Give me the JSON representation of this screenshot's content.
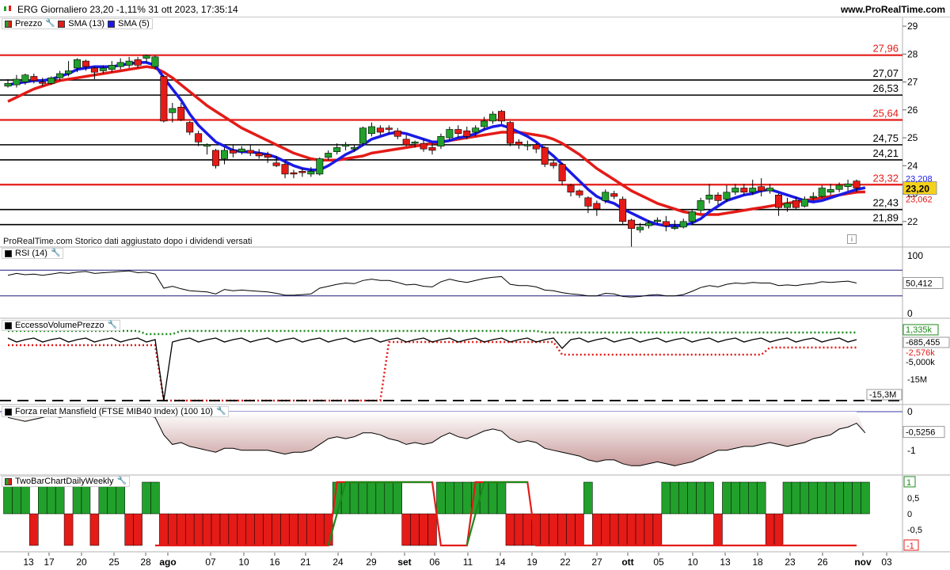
{
  "header": {
    "title": "ERG Giornaliero 23,20 -1,11% 31 ott 2023, 17:35:14",
    "site": "www.ProRealTime.com"
  },
  "colors": {
    "up": "#22a02c",
    "down": "#e41b17",
    "sma13": "#e41b17",
    "sma5": "#1a1ae6",
    "rsi_line": "#1a1a7a",
    "mansfield_fill": "#d9b4b4"
  },
  "price_panel": {
    "legend": {
      "price": "Prezzo",
      "sma13": "SMA (13)",
      "sma5": "SMA (5)"
    },
    "note": "ProRealTime.com  Storico dati aggiustato dopo i dividendi versati",
    "axis_ticks": [
      "29",
      "28",
      "27",
      "26",
      "25",
      "24",
      "23",
      "22"
    ],
    "levels": [
      {
        "value": 27.96,
        "label": "27,96",
        "color": "#e41b17"
      },
      {
        "value": 27.07,
        "label": "27,07",
        "color": "#000000"
      },
      {
        "value": 26.53,
        "label": "26,53",
        "color": "#000000"
      },
      {
        "value": 25.64,
        "label": "25,64",
        "color": "#e41b17"
      },
      {
        "value": 24.75,
        "label": "24,75",
        "color": "#000000"
      },
      {
        "value": 24.21,
        "label": "24,21",
        "color": "#000000"
      },
      {
        "value": 23.32,
        "label": "23,32",
        "color": "#e41b17"
      },
      {
        "value": 22.43,
        "label": "22,43",
        "color": "#000000"
      },
      {
        "value": 21.89,
        "label": "21,89",
        "color": "#000000"
      }
    ],
    "last_price_label": "23,20",
    "sma5_label": "23,208",
    "sma13_label": "23,062"
  },
  "rsi_panel": {
    "legend": "RSI (14)",
    "axis_top": "100",
    "axis_bottom": "0",
    "value_label": "50,412",
    "upper": 70,
    "lower": 30
  },
  "volume_panel": {
    "legend": "EccessoVolumePrezzo",
    "labels": {
      "green": "1,335k",
      "black": "-685,455",
      "tick5": "-5,000k",
      "red": "-2,576k",
      "tick15": "-15M",
      "dash": "-15,3M"
    }
  },
  "mansfield_panel": {
    "legend": "Forza relat Mansfield (FTSE MIB40 Index) (100 10)",
    "axis_ticks": [
      "0",
      "-1"
    ],
    "value_label": "-0,5256"
  },
  "twobar_panel": {
    "legend": "TwoBarChartDailyWeekly",
    "axis_ticks": [
      "1",
      "0,5",
      "0",
      "-0,5",
      "-1"
    ],
    "top_label": "1",
    "bottom_label": "-1"
  },
  "x_axis": {
    "labels": [
      "13",
      "17",
      "20",
      "25",
      "28",
      "ago",
      "07",
      "10",
      "16",
      "21",
      "24",
      "29",
      "set",
      "06",
      "11",
      "14",
      "19",
      "22",
      "27",
      "ott",
      "05",
      "10",
      "13",
      "18",
      "23",
      "26",
      "nov",
      "03"
    ]
  },
  "chart_data": {
    "type": "candlestick",
    "title": "ERG Giornaliero",
    "ylim": [
      21.2,
      29.2
    ],
    "candles": [
      [
        26.85,
        26.95,
        26.8,
        27.1
      ],
      [
        26.9,
        27.1,
        26.8,
        27.25
      ],
      [
        27.0,
        27.25,
        26.9,
        27.3
      ],
      [
        27.2,
        27.05,
        26.95,
        27.3
      ],
      [
        27.0,
        26.95,
        26.85,
        27.15
      ],
      [
        26.95,
        27.15,
        26.9,
        27.2
      ],
      [
        27.15,
        27.3,
        27.05,
        27.4
      ],
      [
        27.3,
        27.4,
        27.2,
        27.75
      ],
      [
        27.5,
        27.8,
        27.35,
        27.85
      ],
      [
        27.75,
        27.55,
        27.4,
        27.8
      ],
      [
        27.5,
        27.35,
        27.1,
        27.55
      ],
      [
        27.4,
        27.5,
        27.3,
        27.6
      ],
      [
        27.45,
        27.6,
        27.35,
        27.75
      ],
      [
        27.55,
        27.7,
        27.45,
        27.85
      ],
      [
        27.6,
        27.75,
        27.5,
        27.9
      ],
      [
        27.8,
        27.6,
        27.5,
        27.9
      ],
      [
        27.85,
        27.95,
        27.7,
        27.98
      ],
      [
        27.55,
        27.9,
        27.45,
        27.95
      ],
      [
        27.2,
        25.6,
        25.55,
        27.25
      ],
      [
        25.9,
        26.05,
        25.55,
        26.25
      ],
      [
        26.1,
        25.65,
        25.6,
        26.25
      ],
      [
        25.55,
        25.2,
        25.1,
        25.6
      ],
      [
        25.15,
        24.85,
        24.7,
        25.25
      ],
      [
        24.7,
        24.75,
        24.4,
        24.8
      ],
      [
        24.55,
        24.0,
        23.9,
        24.6
      ],
      [
        24.25,
        24.55,
        24.05,
        24.65
      ],
      [
        24.55,
        24.45,
        24.3,
        24.75
      ],
      [
        24.5,
        24.6,
        24.4,
        24.7
      ],
      [
        24.55,
        24.45,
        24.35,
        24.75
      ],
      [
        24.45,
        24.35,
        24.25,
        24.6
      ],
      [
        24.4,
        24.3,
        24.1,
        24.5
      ],
      [
        24.1,
        24.0,
        23.95,
        24.35
      ],
      [
        24.05,
        23.7,
        23.55,
        24.15
      ],
      [
        23.75,
        23.7,
        23.55,
        23.85
      ],
      [
        23.8,
        23.75,
        23.6,
        23.9
      ],
      [
        23.7,
        23.8,
        23.6,
        23.95
      ],
      [
        23.7,
        24.25,
        23.65,
        24.3
      ],
      [
        24.3,
        24.45,
        24.2,
        24.55
      ],
      [
        24.5,
        24.65,
        24.4,
        24.8
      ],
      [
        24.7,
        24.75,
        24.55,
        24.85
      ],
      [
        24.6,
        24.65,
        24.5,
        24.75
      ],
      [
        24.8,
        25.35,
        24.7,
        25.4
      ],
      [
        25.15,
        25.4,
        25.05,
        25.55
      ],
      [
        25.35,
        25.2,
        25.1,
        25.45
      ],
      [
        25.35,
        25.3,
        25.15,
        25.45
      ],
      [
        25.25,
        25.05,
        24.95,
        25.35
      ],
      [
        24.95,
        24.75,
        24.7,
        25.1
      ],
      [
        24.8,
        24.85,
        24.65,
        24.9
      ],
      [
        24.8,
        24.6,
        24.5,
        24.95
      ],
      [
        24.65,
        24.55,
        24.4,
        24.8
      ],
      [
        24.7,
        25.05,
        24.6,
        25.15
      ],
      [
        25.0,
        25.3,
        24.9,
        25.4
      ],
      [
        25.3,
        25.15,
        25.0,
        25.45
      ],
      [
        25.25,
        25.05,
        24.95,
        25.4
      ],
      [
        25.2,
        25.35,
        25.05,
        25.45
      ],
      [
        25.4,
        25.6,
        25.3,
        25.75
      ],
      [
        25.6,
        25.85,
        25.5,
        25.95
      ],
      [
        25.95,
        25.6,
        25.5,
        26.0
      ],
      [
        25.55,
        24.8,
        24.7,
        25.6
      ],
      [
        24.85,
        24.75,
        24.6,
        24.95
      ],
      [
        24.75,
        24.75,
        24.55,
        24.9
      ],
      [
        24.75,
        24.6,
        24.45,
        24.8
      ],
      [
        24.65,
        24.05,
        23.95,
        24.7
      ],
      [
        24.1,
        24.0,
        23.9,
        24.2
      ],
      [
        24.05,
        23.45,
        23.3,
        24.1
      ],
      [
        23.3,
        23.05,
        22.9,
        23.35
      ],
      [
        23.1,
        22.95,
        22.85,
        23.15
      ],
      [
        22.85,
        22.55,
        22.3,
        22.9
      ],
      [
        22.65,
        22.45,
        22.2,
        22.75
      ],
      [
        22.75,
        23.05,
        22.65,
        23.15
      ],
      [
        23.0,
        22.9,
        22.8,
        23.1
      ],
      [
        22.8,
        22.0,
        21.9,
        22.9
      ],
      [
        22.05,
        21.75,
        21.1,
        22.1
      ],
      [
        21.7,
        21.8,
        21.6,
        21.95
      ],
      [
        21.85,
        21.95,
        21.75,
        22.05
      ],
      [
        22.0,
        22.05,
        21.9,
        22.15
      ],
      [
        22.0,
        21.85,
        21.65,
        22.2
      ],
      [
        21.75,
        21.8,
        21.7,
        22.05
      ],
      [
        21.8,
        22.0,
        21.75,
        22.1
      ],
      [
        22.0,
        22.35,
        21.9,
        22.45
      ],
      [
        22.4,
        22.75,
        22.3,
        22.85
      ],
      [
        22.8,
        22.95,
        22.65,
        23.35
      ],
      [
        22.95,
        22.75,
        22.6,
        23.05
      ],
      [
        22.8,
        23.05,
        22.7,
        23.3
      ],
      [
        23.05,
        23.2,
        22.95,
        23.35
      ],
      [
        23.2,
        23.05,
        22.95,
        23.35
      ],
      [
        23.05,
        23.2,
        22.95,
        23.5
      ],
      [
        23.25,
        23.1,
        22.9,
        23.55
      ],
      [
        23.1,
        23.2,
        23.0,
        23.35
      ],
      [
        22.95,
        22.5,
        22.2,
        23.0
      ],
      [
        22.5,
        22.65,
        22.35,
        22.85
      ],
      [
        22.75,
        22.5,
        22.45,
        22.9
      ],
      [
        22.55,
        22.8,
        22.5,
        22.9
      ],
      [
        22.85,
        22.9,
        22.75,
        23.05
      ],
      [
        22.9,
        23.2,
        22.85,
        23.3
      ],
      [
        23.05,
        23.15,
        22.95,
        23.35
      ],
      [
        23.15,
        23.3,
        23.05,
        23.4
      ],
      [
        23.25,
        23.35,
        23.1,
        23.5
      ],
      [
        23.45,
        23.2,
        23.05,
        23.5
      ]
    ],
    "sma13": [
      26.3,
      26.45,
      26.6,
      26.75,
      26.85,
      26.95,
      27.05,
      27.1,
      27.15,
      27.2,
      27.25,
      27.3,
      27.35,
      27.4,
      27.45,
      27.5,
      27.55,
      27.5,
      27.35,
      27.15,
      26.9,
      26.65,
      26.4,
      26.15,
      25.95,
      25.75,
      25.55,
      25.35,
      25.2,
      25.05,
      24.9,
      24.75,
      24.6,
      24.45,
      24.35,
      24.25,
      24.2,
      24.2,
      24.2,
      24.25,
      24.3,
      24.35,
      24.45,
      24.5,
      24.55,
      24.6,
      24.65,
      24.7,
      24.75,
      24.8,
      24.85,
      24.9,
      24.95,
      25.0,
      25.05,
      25.1,
      25.15,
      25.2,
      25.2,
      25.2,
      25.15,
      25.1,
      25.05,
      24.95,
      24.8,
      24.6,
      24.4,
      24.15,
      23.9,
      23.7,
      23.5,
      23.3,
      23.1,
      22.95,
      22.8,
      22.65,
      22.55,
      22.45,
      22.35,
      22.3,
      22.25,
      22.25,
      22.25,
      22.3,
      22.35,
      22.4,
      22.45,
      22.5,
      22.55,
      22.6,
      22.65,
      22.7,
      22.75,
      22.8,
      22.85,
      22.9,
      22.95,
      23.0,
      23.05,
      23.06
    ],
    "sma5": [
      26.9,
      26.95,
      27.0,
      27.05,
      27.05,
      27.1,
      27.2,
      27.3,
      27.45,
      27.5,
      27.55,
      27.55,
      27.55,
      27.6,
      27.65,
      27.7,
      27.7,
      27.6,
      27.15,
      26.75,
      26.35,
      25.85,
      25.45,
      25.15,
      24.85,
      24.7,
      24.55,
      24.5,
      24.5,
      24.45,
      24.4,
      24.3,
      24.15,
      24.0,
      23.9,
      23.85,
      23.85,
      24.0,
      24.2,
      24.4,
      24.55,
      24.75,
      24.95,
      25.05,
      25.15,
      25.2,
      25.15,
      25.05,
      24.95,
      24.85,
      24.85,
      24.9,
      25.0,
      25.05,
      25.15,
      25.3,
      25.4,
      25.45,
      25.35,
      25.2,
      25.05,
      24.85,
      24.6,
      24.35,
      24.05,
      23.75,
      23.45,
      23.15,
      22.9,
      22.75,
      22.65,
      22.45,
      22.3,
      22.15,
      22.0,
      21.9,
      21.85,
      21.85,
      21.85,
      21.95,
      22.1,
      22.35,
      22.55,
      22.75,
      22.85,
      22.95,
      23.0,
      23.1,
      23.15,
      23.05,
      22.95,
      22.85,
      22.75,
      22.7,
      22.75,
      22.85,
      22.95,
      23.05,
      23.15,
      23.21
    ],
    "rsi": [
      62,
      65,
      63,
      64,
      62,
      64,
      66,
      65,
      67,
      68,
      65,
      66,
      67,
      68,
      69,
      66,
      67,
      64,
      42,
      45,
      41,
      38,
      37,
      36,
      33,
      40,
      38,
      39,
      38,
      37,
      36,
      34,
      31,
      31,
      32,
      33,
      42,
      45,
      48,
      50,
      49,
      54,
      56,
      54,
      54,
      51,
      47,
      48,
      45,
      44,
      52,
      56,
      53,
      51,
      54,
      57,
      59,
      60,
      48,
      46,
      46,
      44,
      39,
      38,
      35,
      33,
      32,
      30,
      30,
      34,
      33,
      29,
      28,
      29,
      31,
      32,
      30,
      30,
      32,
      37,
      43,
      46,
      44,
      48,
      50,
      49,
      51,
      50,
      50,
      46,
      47,
      46,
      48,
      49,
      52,
      51,
      52,
      53,
      50
    ],
    "mansfield": [
      -0.15,
      -0.2,
      -0.25,
      -0.2,
      -0.15,
      -0.1,
      -0.15,
      -0.1,
      -0.05,
      -0.1,
      -0.15,
      -0.1,
      -0.05,
      -0.05,
      -0.1,
      -0.05,
      -0.1,
      -0.15,
      -0.6,
      -0.85,
      -0.8,
      -0.9,
      -0.95,
      -1.0,
      -1.05,
      -0.95,
      -0.95,
      -1.0,
      -1.0,
      -1.0,
      -1.0,
      -1.05,
      -1.1,
      -1.05,
      -1.05,
      -1.0,
      -0.85,
      -0.7,
      -0.65,
      -0.7,
      -0.65,
      -0.55,
      -0.55,
      -0.6,
      -0.7,
      -0.75,
      -0.85,
      -0.8,
      -0.85,
      -0.8,
      -0.65,
      -0.55,
      -0.65,
      -0.7,
      -0.6,
      -0.5,
      -0.45,
      -0.5,
      -0.7,
      -0.8,
      -0.75,
      -0.8,
      -0.95,
      -1.0,
      -1.05,
      -1.1,
      -1.15,
      -1.25,
      -1.3,
      -1.25,
      -1.25,
      -1.35,
      -1.4,
      -1.4,
      -1.35,
      -1.3,
      -1.35,
      -1.4,
      -1.35,
      -1.3,
      -1.2,
      -1.1,
      -1.0,
      -1.0,
      -0.95,
      -0.9,
      -0.9,
      -0.85,
      -0.8,
      -0.85,
      -0.9,
      -0.85,
      -0.8,
      -0.7,
      -0.65,
      -0.6,
      -0.45,
      -0.4,
      -0.3,
      -0.55
    ],
    "twobar": [
      1,
      1,
      1,
      -1,
      1,
      1,
      1,
      -1,
      1,
      1,
      -1,
      1,
      1,
      1,
      -1,
      -1,
      1,
      1,
      -1,
      -1,
      -1,
      -1,
      -1,
      -1,
      -1,
      -1,
      -1,
      -1,
      -1,
      -1,
      -1,
      -1,
      -1,
      -1,
      -1,
      -1,
      -1,
      -1,
      1,
      1,
      1,
      1,
      1,
      1,
      1,
      1,
      -1,
      -1,
      -1,
      -1,
      1,
      1,
      1,
      1,
      1,
      1,
      1,
      1,
      -1,
      -1,
      -1,
      -1,
      -1,
      -1,
      -1,
      -1,
      -1,
      1,
      -1,
      -1,
      -1,
      -1,
      -1,
      -1,
      -1,
      -1,
      1,
      1,
      1,
      1,
      1,
      1,
      -1,
      1,
      1,
      1,
      1,
      1,
      -1,
      -1,
      1,
      1,
      1,
      1,
      1,
      1,
      1,
      1,
      1,
      1
    ]
  }
}
